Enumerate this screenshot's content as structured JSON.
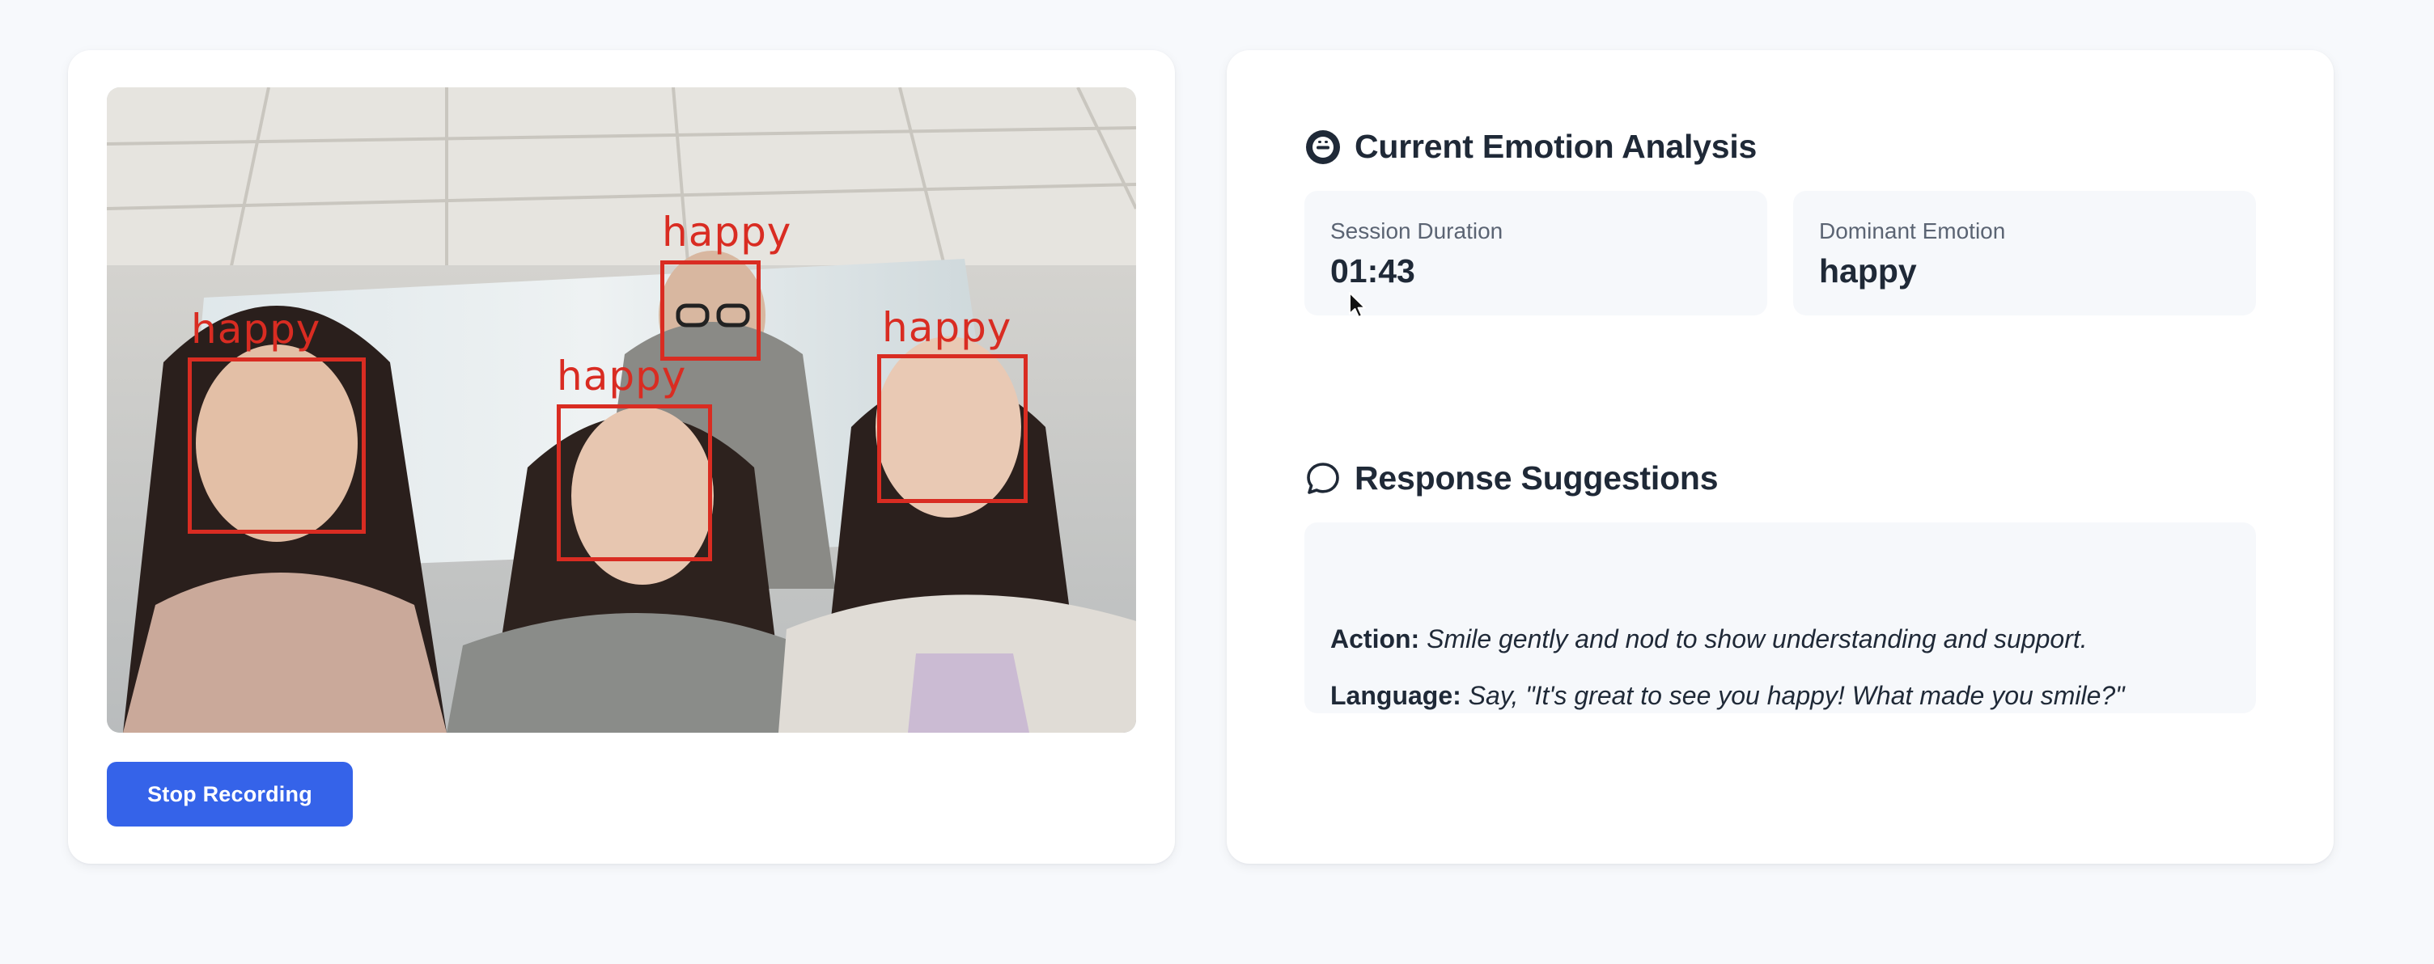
{
  "video": {
    "faces": [
      {
        "label": "happy"
      },
      {
        "label": "happy"
      },
      {
        "label": "happy"
      },
      {
        "label": "happy"
      }
    ]
  },
  "controls": {
    "stop_label": "Stop Recording"
  },
  "emotion_panel": {
    "title": "Current Emotion Analysis",
    "title_icon": "neutral-face-icon",
    "session_duration_label": "Session Duration",
    "session_duration_value": "01:43",
    "dominant_emotion_label": "Dominant Emotion",
    "dominant_emotion_value": "happy"
  },
  "suggestions": {
    "title": "Response Suggestions",
    "title_icon": "chat-bubble-icon",
    "action_label": "Action:",
    "action_text": "Smile gently and nod to show understanding and support.",
    "language_label": "Language:",
    "language_text": "Say, \"It's great to see you happy! What made you smile?\""
  },
  "colors": {
    "accent": "#3563e9",
    "detection_box": "#d92c22",
    "background": "#f7f9fc"
  }
}
